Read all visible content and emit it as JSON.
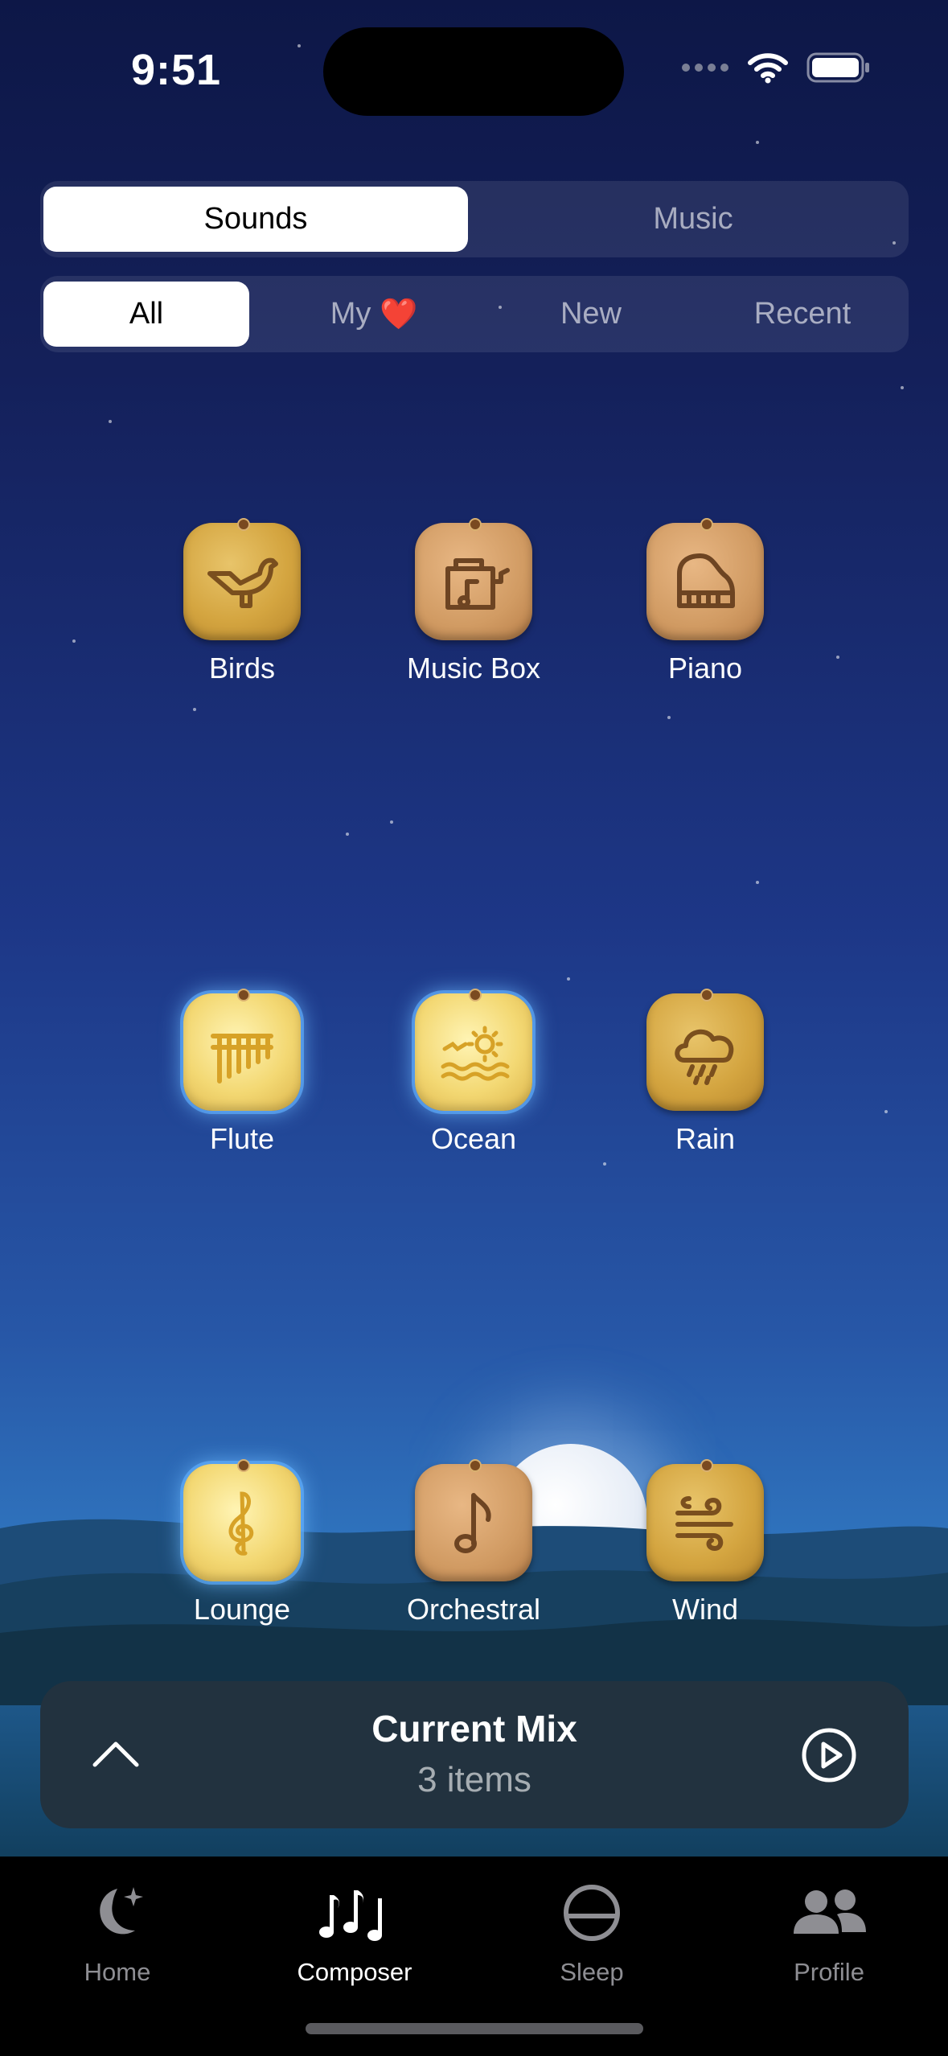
{
  "status": {
    "time": "9:51"
  },
  "segment_primary": {
    "options": [
      "Sounds",
      "Music"
    ],
    "selected": "Sounds"
  },
  "segment_filter": {
    "options": [
      "All",
      "My",
      "New",
      "Recent"
    ],
    "selected": "All",
    "my_emoji": "❤️"
  },
  "sounds": [
    {
      "label": "Birds",
      "icon": "bird-icon",
      "active": false
    },
    {
      "label": "Music Box",
      "icon": "music-box-icon",
      "active": false
    },
    {
      "label": "Piano",
      "icon": "piano-icon",
      "active": false
    },
    {
      "label": "Flute",
      "icon": "flute-icon",
      "active": true
    },
    {
      "label": "Ocean",
      "icon": "ocean-icon",
      "active": true
    },
    {
      "label": "Rain",
      "icon": "rain-icon",
      "active": false
    },
    {
      "label": "Lounge",
      "icon": "treble-clef-icon",
      "active": true
    },
    {
      "label": "Orchestral",
      "icon": "music-note-icon",
      "active": false
    },
    {
      "label": "Wind",
      "icon": "wind-icon",
      "active": false
    }
  ],
  "current_mix": {
    "title": "Current Mix",
    "subtitle": "3 items"
  },
  "tabbar": {
    "items": [
      {
        "label": "Home",
        "icon": "moon-stars-icon"
      },
      {
        "label": "Composer",
        "icon": "music-notes-icon"
      },
      {
        "label": "Sleep",
        "icon": "sleep-icon"
      },
      {
        "label": "Profile",
        "icon": "people-icon"
      }
    ],
    "selected": "Composer"
  }
}
